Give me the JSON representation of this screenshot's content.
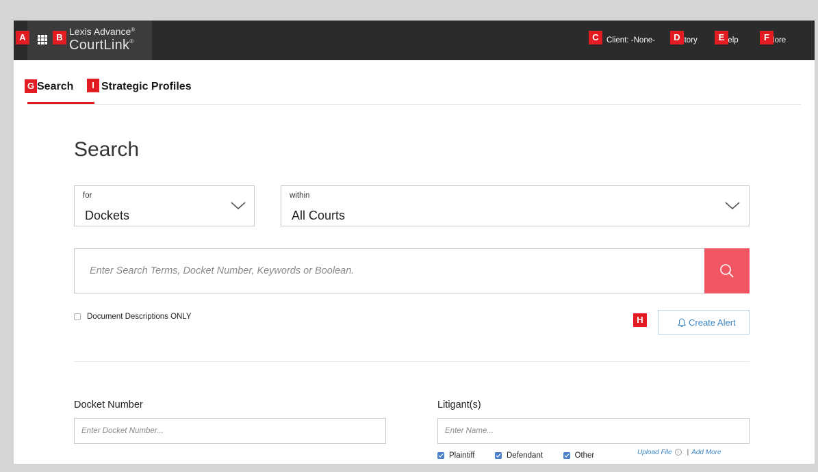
{
  "header": {
    "brand_line1": "Lexis Advance",
    "brand_line2": "CourtLink",
    "registered_mark": "®",
    "nav": {
      "client": "Client: -None-",
      "history": "History",
      "help": "Help",
      "more": "More"
    }
  },
  "markers": {
    "a": "A",
    "b": "B",
    "c": "C",
    "d": "D",
    "e": "E",
    "f": "F",
    "g": "G",
    "h": "H",
    "i": "I"
  },
  "tabs": {
    "search": "Search",
    "strategic_profiles": "Strategic Profiles"
  },
  "search_form": {
    "heading": "Search",
    "for_select": {
      "label": "for",
      "value": "Dockets"
    },
    "within_select": {
      "label": "within",
      "value": "All Courts"
    },
    "search_placeholder": "Enter Search Terms, Docket Number, Keywords or Boolean.",
    "document_descriptions_only": "Document Descriptions ONLY",
    "create_alert": "Create Alert"
  },
  "docket_number": {
    "label": "Docket Number",
    "placeholder": "Enter Docket Number..."
  },
  "litigants": {
    "label": "Litigant(s)",
    "placeholder": "Enter Name...",
    "options": [
      "Plaintiff",
      "Defendant",
      "Other"
    ],
    "upload_file": "Upload File",
    "info_glyph": "i",
    "separator": "|",
    "add_more": "Add More"
  },
  "colors": {
    "topbar": "#2b2b2b",
    "accent_red": "#e31c23",
    "search_button": "#f05763",
    "link_blue": "#3b84c4",
    "checkbox_blue": "#4a7fc9"
  },
  "icons": {
    "apps": "apps-grid-icon",
    "search": "search-icon",
    "bell": "bell-icon",
    "chevron": "chevron-down-icon",
    "info": "info-icon",
    "check": "check-icon"
  }
}
